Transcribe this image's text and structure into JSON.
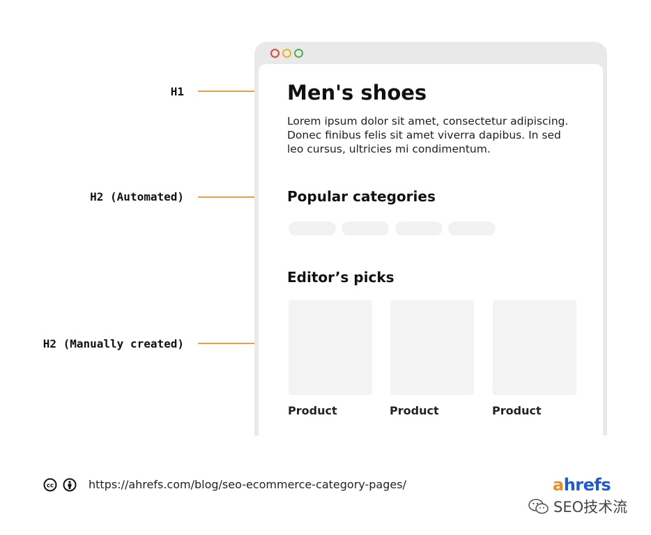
{
  "annotations": {
    "h1": "H1",
    "h2_auto": "H2 (Automated)",
    "h2_manual": "H2 (Manually created)"
  },
  "page": {
    "title": "Men's shoes",
    "intro": "Lorem ipsum dolor sit amet, consectetur adipiscing. Donec finibus felis sit amet viverra dapibus. In sed leo cursus, ultricies mi condimentum.",
    "section_popular": "Popular categories",
    "section_editors": "Editor’s picks",
    "products": [
      "Product",
      "Product",
      "Product"
    ]
  },
  "window_controls": {
    "colors": [
      "#e0453c",
      "#e6b423",
      "#4fae4c"
    ]
  },
  "footer": {
    "url": "https://ahrefs.com/blog/seo-ecommerce-category-pages/",
    "license_icons": [
      "creative-commons-icon",
      "attribution-icon"
    ]
  },
  "brand": {
    "first_letter": "a",
    "rest": "hrefs",
    "first_letter_color": "#f08c1e",
    "rest_color": "#1d5ad6"
  },
  "watermark": {
    "text": "SEO技术流",
    "icon": "wechat-icon"
  },
  "colors": {
    "annotation_line": "#e0a34a"
  }
}
